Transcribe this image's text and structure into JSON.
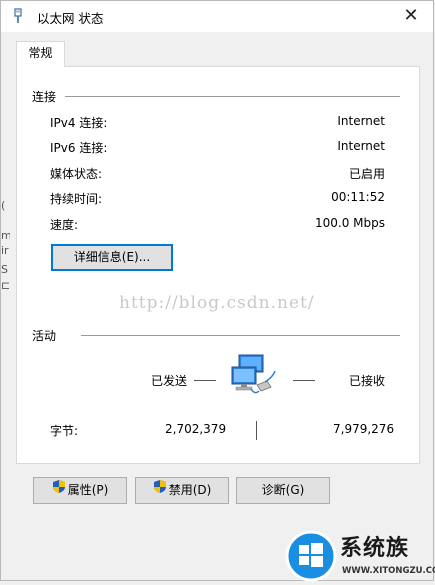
{
  "window": {
    "title": "以太网 状态",
    "close_glyph": "✕",
    "icon": "ethernet-plug-icon"
  },
  "tabs": [
    {
      "label": "常规"
    }
  ],
  "connection": {
    "section_title": "连接",
    "rows": [
      {
        "label": "IPv4 连接:",
        "value": "Internet"
      },
      {
        "label": "IPv6 连接:",
        "value": "Internet"
      },
      {
        "label": "媒体状态:",
        "value": "已启用"
      },
      {
        "label": "持续时间:",
        "value": "00:11:52"
      },
      {
        "label": "速度:",
        "value": "100.0 Mbps"
      }
    ],
    "details_button": "详细信息(E)..."
  },
  "activity": {
    "section_title": "活动",
    "sent_label": "已发送",
    "received_label": "已接收",
    "bytes_label": "字节:",
    "bytes_sent": "2,702,379",
    "bytes_received": "7,979,276",
    "icon": "network-computers-icon"
  },
  "buttons": {
    "properties": "属性(P)",
    "disable": "禁用(D)",
    "diagnose": "诊断(G)"
  },
  "watermark": "http://blog.csdn.net/",
  "logo": {
    "text": "系统族",
    "url": "WWW.XITONGZU.COM"
  },
  "colors": {
    "accent": "#0078d7",
    "shield_blue": "#1f5fbf",
    "shield_yellow": "#f2c200"
  }
}
